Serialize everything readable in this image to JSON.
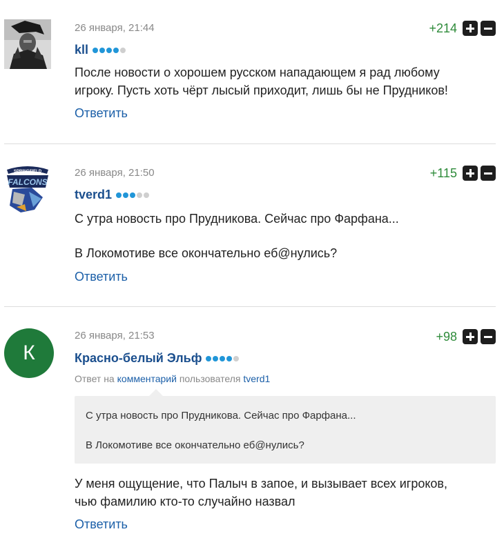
{
  "comments": [
    {
      "date": "26 января, 21:44",
      "author": "kll",
      "score": "+214",
      "rating_dots": 4,
      "text_lines": [
        "После новости о хорошем русском нападающем я рад любому",
        "игроку. Пусть хоть чёрт лысый приходит, лишь бы не Прудников!"
      ],
      "reply_label": "Ответить",
      "avatar": "photo-avatar"
    },
    {
      "date": "26 января, 21:50",
      "author": "tverd1",
      "score": "+115",
      "rating_dots": 3,
      "text_lines": [
        "С утра новость про Прудникова. Сейчас про Фарфана...",
        "В Локомотиве все окончательно еб@нулись?"
      ],
      "reply_label": "Ответить",
      "avatar": "springfield-falcons-logo"
    },
    {
      "date": "26 января, 21:53",
      "author": "Красно-белый Эльф",
      "score": "+98",
      "rating_dots": 4,
      "avatar_letter": "К",
      "reply_to": {
        "prefix": "Ответ на",
        "link": "комментарий",
        "middle": "пользователя",
        "user": "tverd1"
      },
      "quote_lines": [
        "С утра новость про Прудникова. Сейчас про Фарфана...",
        "В Локомотиве все окончательно еб@нулись?"
      ],
      "text_lines": [
        "У меня ощущение, что Палыч в запое, и вызывает всех игроков,",
        "чью фамилию кто-то случайно назвал"
      ],
      "reply_label": "Ответить"
    }
  ],
  "logo_text": {
    "springfield": "SPRINGFIELD",
    "falcons": "FALCONS"
  },
  "colors": {
    "author": "#1b4f8e",
    "link": "#1b5fa8",
    "score": "#2e8b3a",
    "dot_on": "#2196d8",
    "dot_off": "#cfcfcf",
    "avatar_k_bg": "#1f7a3a"
  }
}
